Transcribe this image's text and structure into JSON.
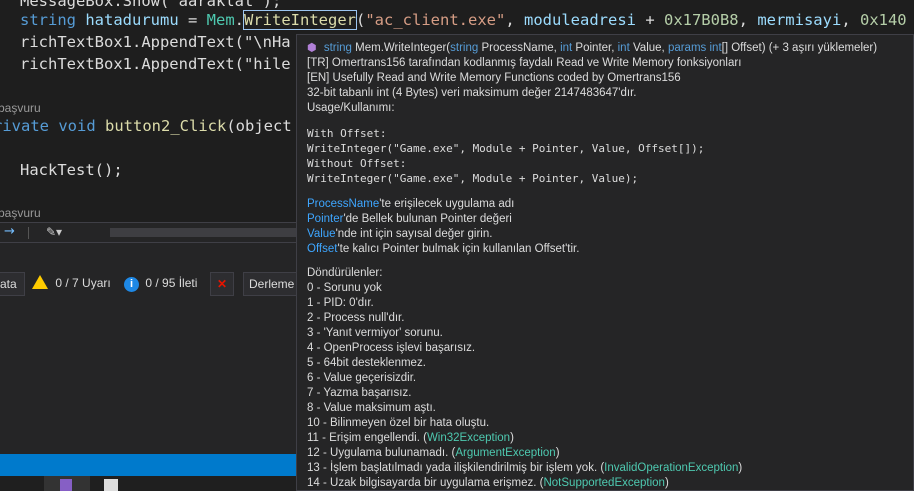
{
  "code": {
    "line0": "MessageBox.Show(\"aaraklat\");",
    "line1": {
      "kw": "string",
      "var": "hatadurumu",
      "eq": " = ",
      "obj": "Mem",
      "dot": ".",
      "method": "WriteInteger",
      "open": "(",
      "s1": "\"ac_client.exe\"",
      "c1": ", ",
      "v1": "moduleadresi",
      "plus": " + ",
      "n1": "0x17B0B8",
      "c2": ", ",
      "v2": "mermisayi",
      "c3": ", ",
      "n2": "0x140"
    },
    "line2": "richTextBox1.AppendText(\"\\nHa",
    "line3": "richTextBox1.AppendText(\"hile",
    "ref1": "başvuru",
    "line4": {
      "kw1": "rivate",
      "kw2": "void",
      "name": "button2_Click",
      "rest": "(object"
    },
    "line5": "HackTest();",
    "ref2": "başvuru"
  },
  "errors": {
    "filter_label": "ata",
    "warnings": "0 / 7 Uyarı",
    "messages": "0 / 95 İleti",
    "build": "Derleme"
  },
  "tooltip": {
    "sig": {
      "type1": "string",
      "member": " Mem.WriteInteger(",
      "t2": "string",
      "p2": " ProcessName, ",
      "t3": "int",
      "p3": " Pointer, ",
      "t4": "int",
      "p4": " Value, ",
      "t5": "params",
      "t6": " int",
      "p5": "[] Offset)",
      "tail": " (+ 3 aşırı yüklemeler)"
    },
    "desc": [
      "[TR] Omertrans156 tarafından kodlanmış faydalı Read ve Write Memory fonksiyonları",
      "[EN] Usefully Read and Write Memory Functions coded by Omertrans156",
      "32-bit tabanlı int (4 Bytes) veri maksimum değer 2147483647'dır.",
      "Usage/Kullanımı:"
    ],
    "code": [
      "With Offset:",
      "WriteInteger(\"Game.exe\", Module + Pointer, Value, Offset[]);",
      "Without Offset:",
      "WriteInteger(\"Game.exe\", Module + Pointer, Value);"
    ],
    "params": [
      {
        "name": "ProcessName",
        "text": "'te erişilecek uygulama adı"
      },
      {
        "name": "Pointer",
        "text": "'de Bellek bulunan Pointer değeri"
      },
      {
        "name": "Value",
        "text": "'nde int için sayısal değer girin."
      },
      {
        "name": "Offset",
        "text": "'te kalıcı Pointer bulmak için kullanılan Offset'tir."
      }
    ],
    "returns_title": "Döndürülenler:",
    "returns": [
      {
        "text": " 0 - Sorunu yok"
      },
      {
        "text": " 1 - PID: 0'dır."
      },
      {
        "text": " 2 - Process null'dır."
      },
      {
        "text": " 3 - 'Yanıt vermiyor' sorunu."
      },
      {
        "text": " 4 - OpenProcess işlevi başarısız."
      },
      {
        "text": " 5 - 64bit desteklenmez."
      },
      {
        "text": " 6 - Value geçerisizdir."
      },
      {
        "text": " 7 - Yazma başarısız."
      },
      {
        "text": " 8 - Value maksimum aştı."
      },
      {
        "text": " 10 - Bilinmeyen özel bir hata oluştu."
      },
      {
        "text": " 11 - Erişim engellendi. (",
        "exc": "Win32Exception",
        "end": ")"
      },
      {
        "text": " 12 - Uygulama bulunamadı. (",
        "exc": "ArgumentException",
        "end": ")"
      },
      {
        "text": " 13 - İşlem başlatılmadı yada ilişkilendirilmiş bir işlem yok. (",
        "exc": "InvalidOperationException",
        "end": ")"
      },
      {
        "text": " 14 - Uzak bilgisayarda bir uygulama erişmez. (",
        "exc": "NotSupportedException",
        "end": ")"
      }
    ]
  }
}
